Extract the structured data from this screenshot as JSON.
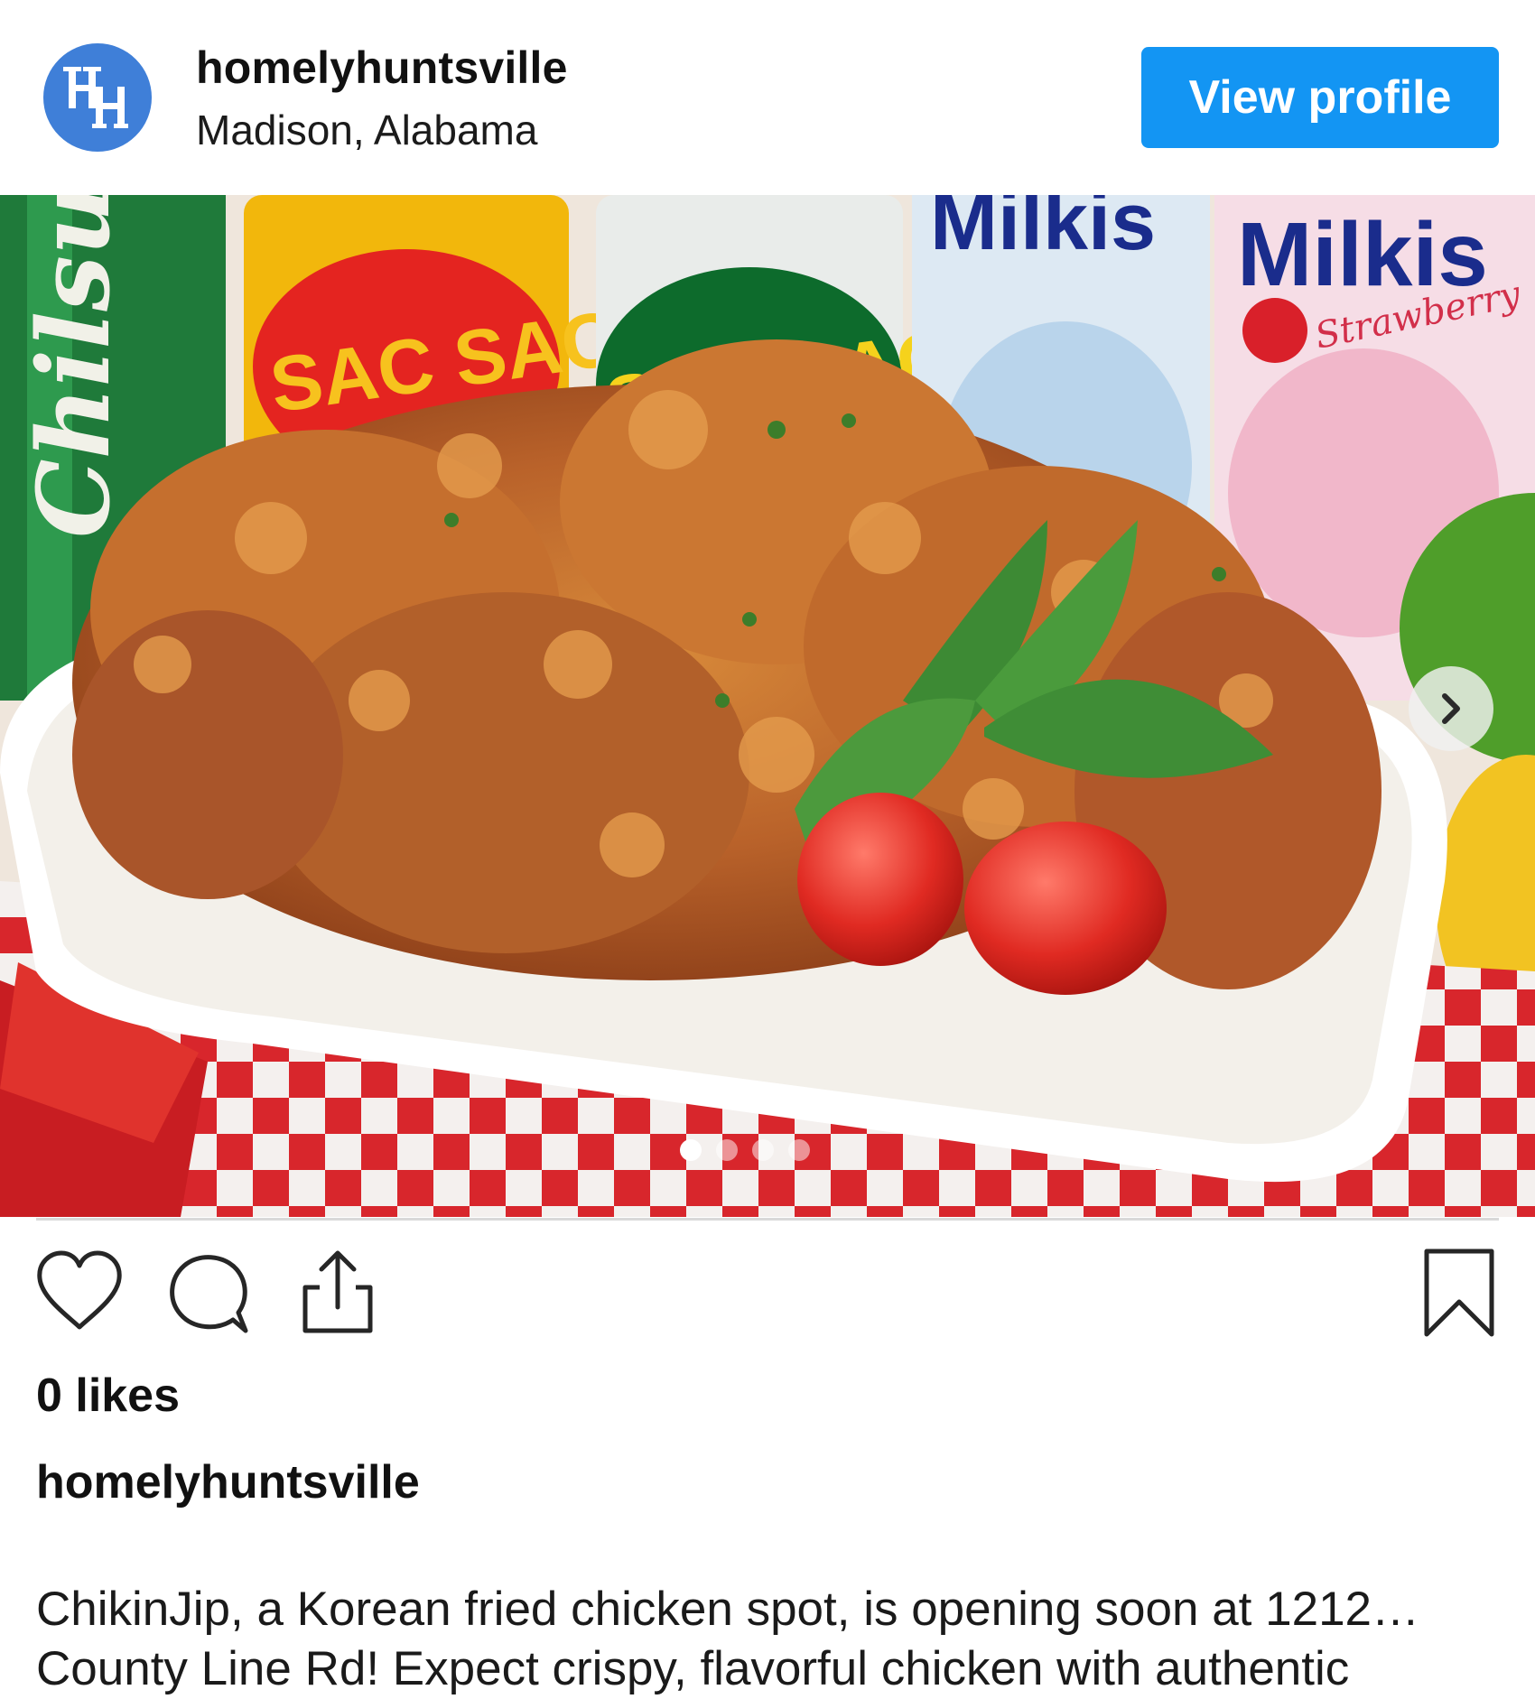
{
  "header": {
    "avatar_label": "HH",
    "username": "homelyhuntsville",
    "location": "Madison, Alabama",
    "view_profile_label": "View profile"
  },
  "post": {
    "carousel": {
      "total": 4,
      "active_index": 0
    },
    "can_labels": [
      "Chilsung",
      "SAC SAC",
      "SAC SAC",
      "Milkis",
      "Milkis",
      "Strawberry"
    ],
    "likes_text": "0 likes",
    "caption_username": "homelyhuntsville",
    "caption_line1": "ChikinJip, a Korean fried chicken spot, is opening soon at 1212…",
    "caption_line2": "County Line Rd! Expect crispy, flavorful chicken with authentic"
  },
  "icons": {
    "like": "heart-icon",
    "comment": "comment-icon",
    "share": "share-icon",
    "save": "bookmark-icon",
    "next": "chevron-right-icon"
  },
  "colors": {
    "accent": "#1395f3",
    "avatar": "#3f7fd8"
  }
}
